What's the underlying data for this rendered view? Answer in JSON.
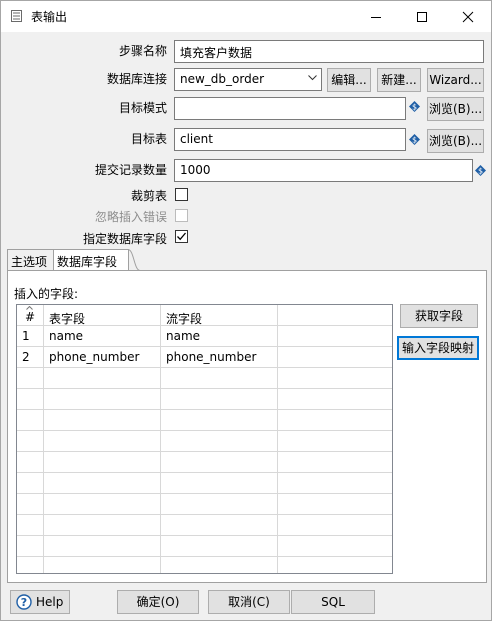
{
  "window": {
    "title": "表输出"
  },
  "form": {
    "step_name_label": "步骤名称",
    "step_name_value": "填充客户数据",
    "db_conn_label": "数据库连接",
    "db_conn_value": "new_db_order",
    "edit_button": "编辑...",
    "new_button": "新建...",
    "wizard_button": "Wizard...",
    "target_schema_label": "目标模式",
    "target_schema_value": "",
    "browse_button": "浏览(B)...",
    "target_table_label": "目标表",
    "target_table_value": "client",
    "commit_size_label": "提交记录数量",
    "commit_size_value": "1000",
    "truncate_label": "裁剪表",
    "truncate_checked": false,
    "ignore_errors_label": "忽略插入错误",
    "ignore_errors_checked": false,
    "specify_fields_label": "指定数据库字段",
    "specify_fields_checked": true
  },
  "tabs": [
    {
      "label": "主选项",
      "active": false
    },
    {
      "label": "数据库字段",
      "active": true
    }
  ],
  "fields_panel": {
    "insert_fields_label": "插入的字段:",
    "columns": [
      "#",
      "表字段",
      "流字段"
    ],
    "rows": [
      {
        "num": "1",
        "table_field": "name",
        "stream_field": "name"
      },
      {
        "num": "2",
        "table_field": "phone_number",
        "stream_field": "phone_number"
      }
    ],
    "get_fields_button": "获取字段",
    "input_mapping_button": "输入字段映射"
  },
  "footer": {
    "help_button": "Help",
    "ok_button": "确定(O)",
    "cancel_button": "取消(C)",
    "sql_button": "SQL"
  },
  "colors": {
    "accent": "#0078d7",
    "variable_icon": "#1f5fa6"
  }
}
